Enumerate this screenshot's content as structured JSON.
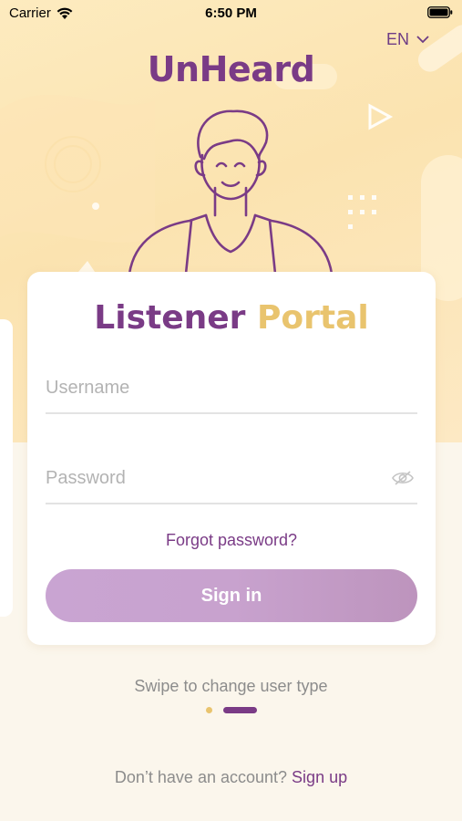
{
  "status_bar": {
    "carrier": "Carrier",
    "time": "6:50 PM"
  },
  "header": {
    "language": "EN",
    "logo_text": "UnHeard"
  },
  "card": {
    "title_part1": "Listener",
    "title_part2": "Portal",
    "username_placeholder": "Username",
    "password_placeholder": "Password",
    "forgot_label": "Forgot password?",
    "signin_label": "Sign in"
  },
  "footer": {
    "swipe_hint": "Swipe to change user type",
    "signup_question": "Don’t have an account?",
    "signup_link": "Sign up",
    "pager": {
      "count": 2,
      "active_index": 1
    }
  },
  "colors": {
    "brand_purple": "#7a3b86",
    "brand_gold": "#e9c46e",
    "button": "#c9a4d2",
    "background": "#fbf6ec"
  },
  "icons": [
    "wifi-icon",
    "battery-icon",
    "chevron-down-icon",
    "eye-off-icon",
    "listener-avatar"
  ]
}
